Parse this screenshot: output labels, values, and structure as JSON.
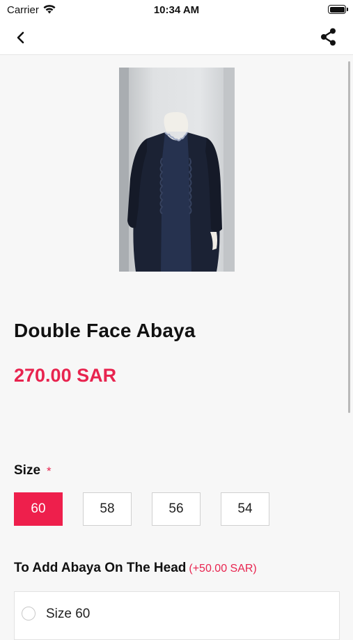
{
  "status_bar": {
    "carrier": "Carrier",
    "time": "10:34 AM"
  },
  "product": {
    "title": "Double Face Abaya",
    "price": "270.00 SAR"
  },
  "size": {
    "label": "Size",
    "required_marker": "*",
    "options": [
      "60",
      "58",
      "56",
      "54"
    ],
    "selected": "60"
  },
  "addon": {
    "title": "To Add Abaya On The Head",
    "price": "(+50.00 SAR)",
    "options": [
      "Size 60"
    ]
  },
  "colors": {
    "accent": "#ee1f4c",
    "background": "#f7f7f7"
  }
}
